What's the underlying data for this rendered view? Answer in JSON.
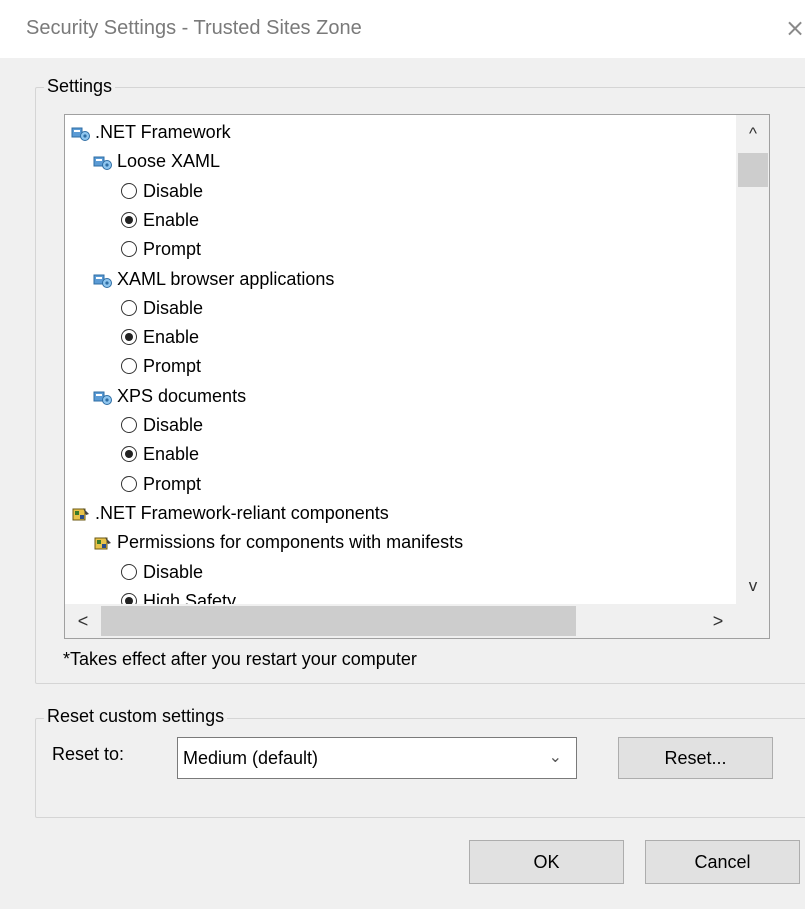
{
  "window": {
    "title": "Security Settings - Trusted Sites Zone",
    "close_glyph": "×"
  },
  "settings": {
    "group_label": "Settings",
    "tree": [
      {
        "type": "category",
        "label": ".NET Framework",
        "icon": "settings-group-icon"
      },
      {
        "type": "subcategory",
        "label": "Loose XAML",
        "icon": "settings-group-icon"
      },
      {
        "type": "option",
        "label": "Disable",
        "checked": false
      },
      {
        "type": "option",
        "label": "Enable",
        "checked": true
      },
      {
        "type": "option",
        "label": "Prompt",
        "checked": false
      },
      {
        "type": "subcategory",
        "label": "XAML browser applications",
        "icon": "settings-group-icon"
      },
      {
        "type": "option",
        "label": "Disable",
        "checked": false
      },
      {
        "type": "option",
        "label": "Enable",
        "checked": true
      },
      {
        "type": "option",
        "label": "Prompt",
        "checked": false
      },
      {
        "type": "subcategory",
        "label": "XPS documents",
        "icon": "settings-group-icon"
      },
      {
        "type": "option",
        "label": "Disable",
        "checked": false
      },
      {
        "type": "option",
        "label": "Enable",
        "checked": true
      },
      {
        "type": "option",
        "label": "Prompt",
        "checked": false
      },
      {
        "type": "category",
        "label": ".NET Framework-reliant components",
        "icon": "components-icon"
      },
      {
        "type": "subcategory",
        "label": "Permissions for components with manifests",
        "icon": "components-icon"
      },
      {
        "type": "option",
        "label": "Disable",
        "checked": false
      },
      {
        "type": "option",
        "label": "High Safety",
        "checked": true
      }
    ],
    "scroll_glyphs": {
      "up": "^",
      "down": "v",
      "left": "<",
      "right": ">"
    },
    "note": "*Takes effect after you restart your computer"
  },
  "reset": {
    "group_label": "Reset custom settings",
    "reset_to_label": "Reset to:",
    "selected_level": "Medium (default)",
    "dropdown_glyph": "⌄",
    "reset_button": "Reset..."
  },
  "buttons": {
    "ok": "OK",
    "cancel": "Cancel"
  }
}
